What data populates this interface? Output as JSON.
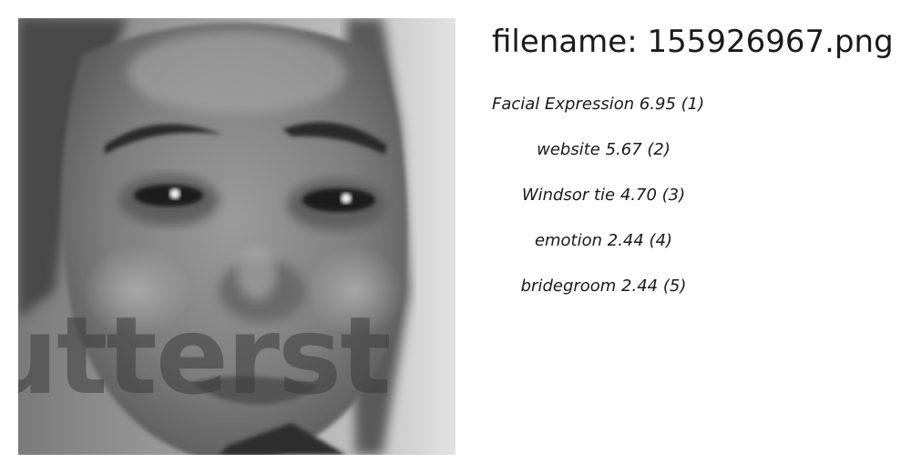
{
  "title": "filename: 155926967.png",
  "photo": {
    "watermark": "utterst"
  },
  "labels": [
    {
      "text": "Facial Expression  6.95 (1)"
    },
    {
      "text": "website  5.67 (2)"
    },
    {
      "text": "Windsor tie  4.70 (3)"
    },
    {
      "text": "emotion  2.44 (4)"
    },
    {
      "text": "bridegroom  2.44 (5)"
    }
  ]
}
